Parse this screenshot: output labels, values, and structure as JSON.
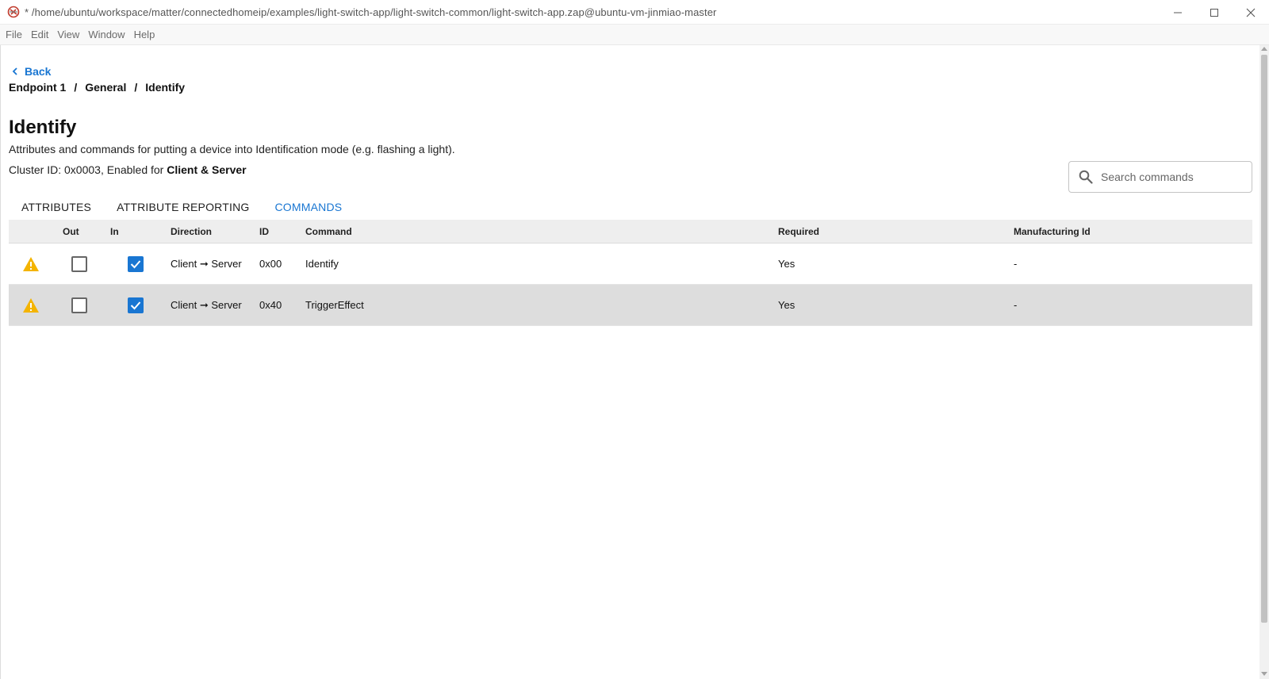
{
  "window": {
    "title": "* /home/ubuntu/workspace/matter/connectedhomeip/examples/light-switch-app/light-switch-common/light-switch-app.zap@ubuntu-vm-jinmiao-master"
  },
  "menu": [
    "File",
    "Edit",
    "View",
    "Window",
    "Help"
  ],
  "nav": {
    "back_label": "Back",
    "breadcrumb": [
      "Endpoint 1",
      "General",
      "Identify"
    ],
    "separator": "/"
  },
  "cluster": {
    "title": "Identify",
    "description": "Attributes and commands for putting a device into Identification mode (e.g. flashing a light).",
    "id_prefix": "Cluster ID: 0x0003, Enabled for ",
    "enabled_for": "Client & Server"
  },
  "search": {
    "placeholder": "Search commands",
    "value": ""
  },
  "tabs": [
    {
      "label": "ATTRIBUTES",
      "active": false
    },
    {
      "label": "ATTRIBUTE REPORTING",
      "active": false
    },
    {
      "label": "COMMANDS",
      "active": true
    }
  ],
  "table": {
    "headers": {
      "warn": "",
      "out": "Out",
      "in": "In",
      "direction": "Direction",
      "id": "ID",
      "command": "Command",
      "required": "Required",
      "manufacturing_id": "Manufacturing Id"
    },
    "rows": [
      {
        "warning": true,
        "out": false,
        "in": true,
        "direction": "Client ➞ Server",
        "id": "0x00",
        "command": "Identify",
        "required": "Yes",
        "manufacturing_id": "-"
      },
      {
        "warning": true,
        "out": false,
        "in": true,
        "direction": "Client ➞ Server",
        "id": "0x40",
        "command": "TriggerEffect",
        "required": "Yes",
        "manufacturing_id": "-"
      }
    ]
  },
  "colors": {
    "accent": "#1976d2",
    "warning": "#f4b400",
    "row_alt": "#dddddd",
    "header_bg": "#eeeeee"
  },
  "icons": {
    "app": "zap-app-icon",
    "back": "chevron-left-icon",
    "search": "search-icon",
    "warning": "warning-icon",
    "check": "check-icon"
  }
}
